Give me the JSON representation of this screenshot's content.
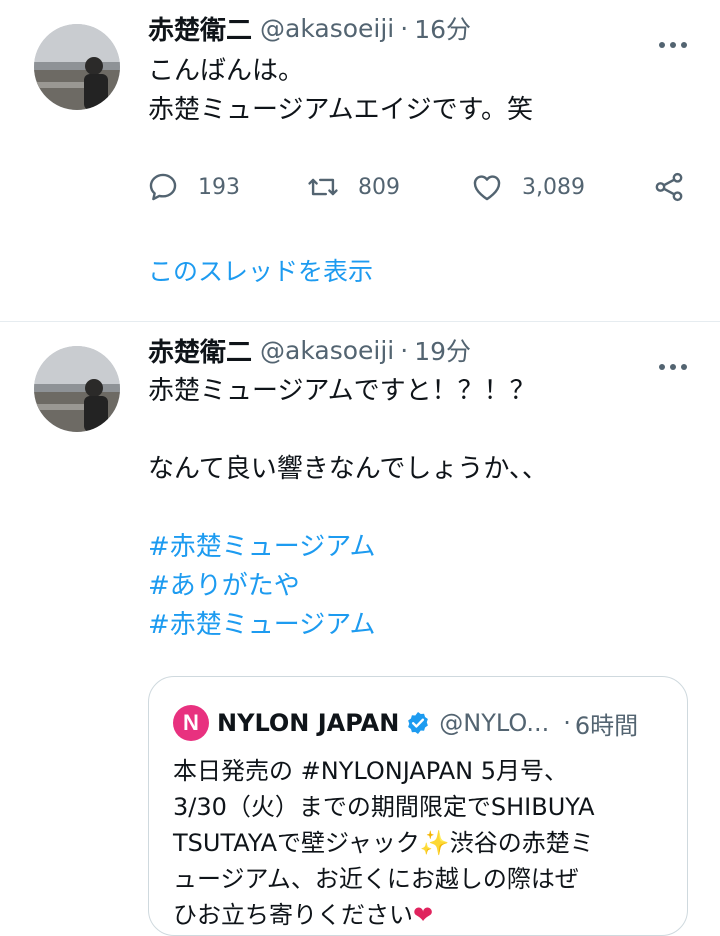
{
  "tweets": [
    {
      "author_name": "赤楚衛二",
      "handle": "@akasoeiji",
      "dot": "·",
      "time": "16分",
      "text_lines": [
        "こんばんは。",
        "赤楚ミュージアムエイジです。笑"
      ],
      "reply_count": "193",
      "retweet_count": "809",
      "like_count": "3,089",
      "thread_link": "このスレッドを表示"
    },
    {
      "author_name": "赤楚衛二",
      "handle": "@akasoeiji",
      "dot": "·",
      "time": "19分",
      "text_lines": [
        "赤楚ミュージアムですと！？！？",
        "",
        "なんて良い響きなんでしょうか、、",
        ""
      ],
      "hashtags": [
        "#赤楚ミュージアム",
        "#ありがたや",
        "#赤楚ミュージアム"
      ],
      "quote": {
        "logo_letter": "N",
        "name": "NYLON JAPAN",
        "handle": "@NYLO...",
        "dot": "·",
        "time": "6時間",
        "lines": [
          "本日発売の #NYLONJAPAN 5月号、",
          "3/30（火）までの期間限定でSHIBUYA",
          "TSUTAYAで壁ジャック",
          "渋谷の赤楚ミ",
          "ュージアム、お近くにお越しの際はぜ",
          "ひお立ち寄りください"
        ],
        "sparkle": "✨",
        "heart": "❤"
      }
    }
  ],
  "icons": {
    "more": "more-horizontal-icon",
    "reply": "reply-icon",
    "retweet": "retweet-icon",
    "like": "heart-icon",
    "share": "share-icon",
    "verified": "verified-badge-icon"
  },
  "colors": {
    "link": "#1d9bf0",
    "secondary": "#536471",
    "nylon_brand": "#e8317f"
  }
}
